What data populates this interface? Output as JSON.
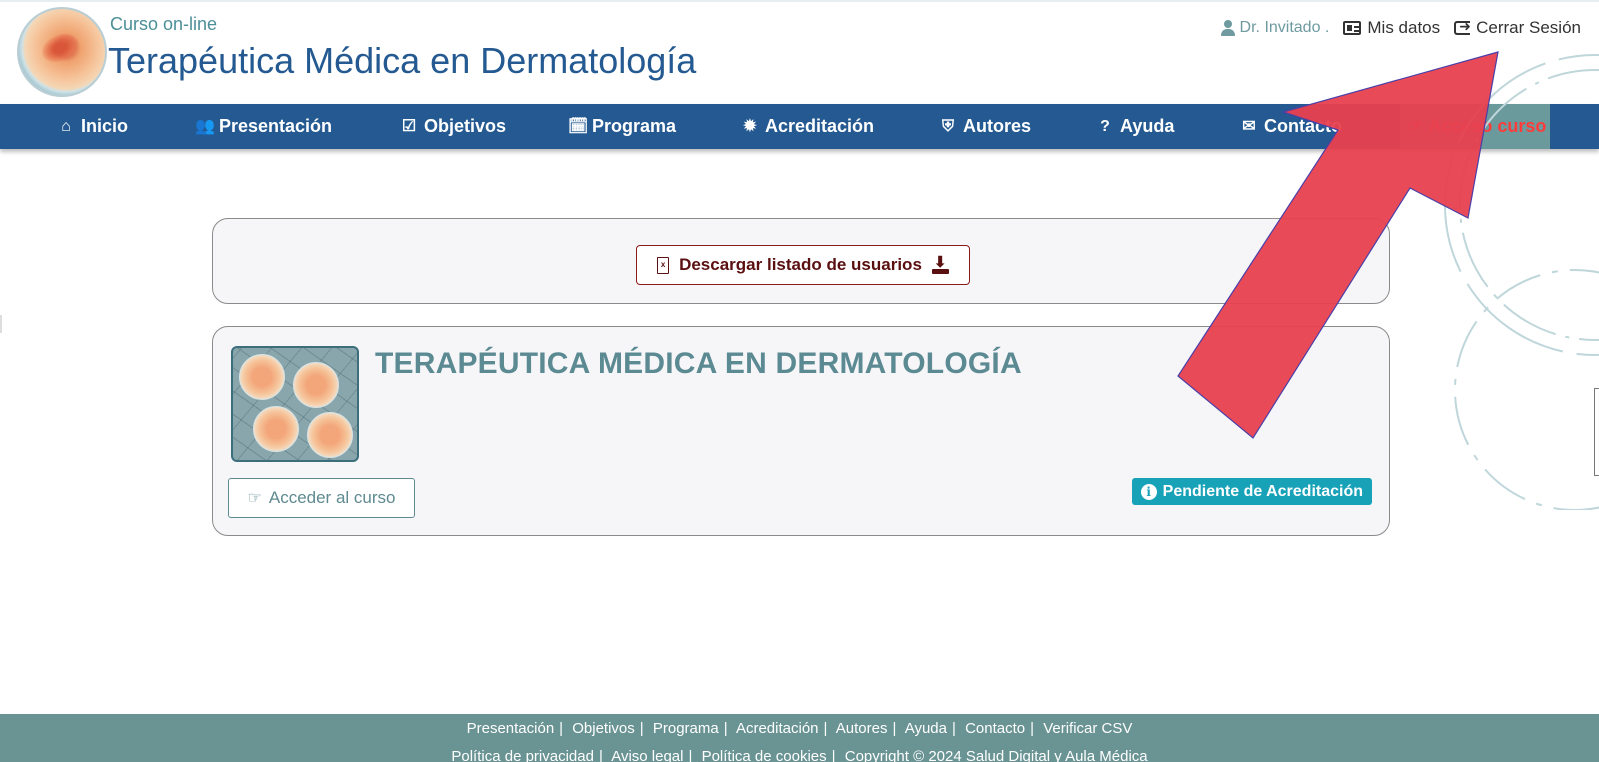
{
  "header": {
    "subtitle": "Curso on-line",
    "title": "Terapéutica Médica en Dermatología",
    "user_name": "Dr. Invitado .",
    "my_data_label": "Mis datos",
    "logout_label": "Cerrar Sesión"
  },
  "nav": {
    "items": [
      {
        "label": "Inicio",
        "icon": "home-icon"
      },
      {
        "label": "Presentación",
        "icon": "users-icon"
      },
      {
        "label": "Objetivos",
        "icon": "check-square-icon"
      },
      {
        "label": "Programa",
        "icon": "calendar-check-icon"
      },
      {
        "label": "Acreditación",
        "icon": "certificate-icon"
      },
      {
        "label": "Autores",
        "icon": "shield-icon"
      },
      {
        "label": "Ayuda",
        "icon": "question-circle-icon"
      },
      {
        "label": "Contacto",
        "icon": "envelope-icon"
      },
      {
        "label": "Acceso curso",
        "icon": "hand-point-right-icon",
        "active": true
      }
    ]
  },
  "download": {
    "label": "Descargar listado de usuarios"
  },
  "course": {
    "title": "TERAPÉUTICA MÉDICA EN DERMATOLOGÍA",
    "access_label": "Acceder al curso",
    "status": "Pendiente de Acreditación"
  },
  "footer": {
    "row1": [
      "Presentación",
      "Objetivos",
      "Programa",
      "Acreditación",
      "Autores",
      "Ayuda",
      "Contacto",
      "Verificar CSV"
    ],
    "row2": [
      "Política de privacidad",
      "Aviso legal",
      "Política de cookies",
      "Copyright © 2024 Salud Digital y Aula Médica"
    ]
  },
  "colors": {
    "brand_blue": "#245a91",
    "teal": "#6a9393",
    "badge": "#17a2b8",
    "arrow": "#e8404f"
  }
}
